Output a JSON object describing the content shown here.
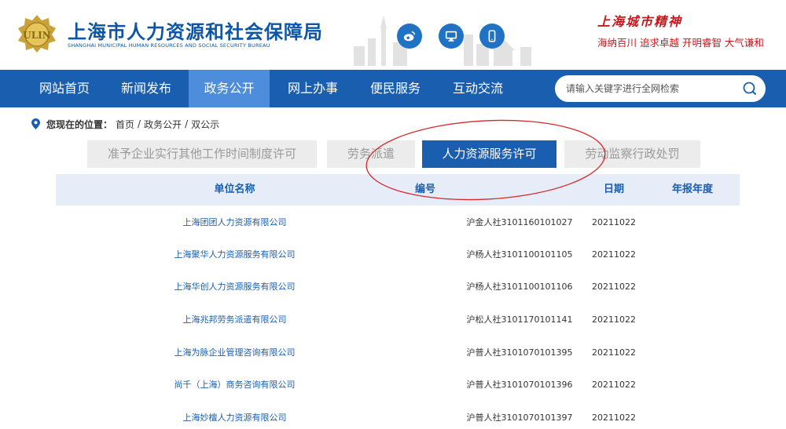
{
  "header": {
    "title": "上海市人力资源和社会保障局",
    "subtitle": "SHANGHAI MUNICIPAL HUMAN RESOURCES AND SOCIAL SECURITY BUREAU",
    "emblem_text": "ULIN",
    "spirit_title": "上海城市精神",
    "spirit_slogan": "海纳百川 追求卓越 开明睿智 大气谦和",
    "social_icons": [
      "weibo-icon",
      "desktop-icon",
      "mobile-icon"
    ]
  },
  "nav": {
    "items": [
      "网站首页",
      "新闻发布",
      "政务公开",
      "网上办事",
      "便民服务",
      "互动交流"
    ],
    "active_index": 2,
    "search_placeholder": "请输入关键字进行全网检索"
  },
  "breadcrumb": {
    "prefix": "您现在的位置：",
    "items": [
      "首页",
      "政务公开",
      "双公示"
    ],
    "separator": "/"
  },
  "tabs": {
    "items": [
      "准予企业实行其他工作时间制度许可",
      "劳务派遣",
      "人力资源服务许可",
      "劳动监察行政处罚"
    ],
    "active_index": 2
  },
  "table": {
    "headers": [
      "单位名称",
      "编号",
      "日期",
      "年报年度"
    ],
    "rows": [
      {
        "name": "上海团团人力资源有限公司",
        "code": "沪金人社3101160101027",
        "date": "20211022",
        "year": ""
      },
      {
        "name": "上海聚华人力资源服务有限公司",
        "code": "沪杨人社3101100101105",
        "date": "20211022",
        "year": ""
      },
      {
        "name": "上海华创人力资源服务有限公司",
        "code": "沪杨人社3101100101106",
        "date": "20211022",
        "year": ""
      },
      {
        "name": "上海兆邦劳务派遣有限公司",
        "code": "沪松人社3101170101141",
        "date": "20211022",
        "year": ""
      },
      {
        "name": "上海为脉企业管理咨询有限公司",
        "code": "沪普人社3101070101395",
        "date": "20211022",
        "year": ""
      },
      {
        "name": "尚千（上海）商务咨询有限公司",
        "code": "沪普人社3101070101396",
        "date": "20211022",
        "year": ""
      },
      {
        "name": "上海妙檀人力资源有限公司",
        "code": "沪普人社3101070101397",
        "date": "20211022",
        "year": ""
      }
    ]
  },
  "colors": {
    "brand_blue": "#1a5eb0",
    "nav_active": "#4d8ddb",
    "spirit_red": "#c8161d",
    "annotation_red": "#d42a2a"
  }
}
